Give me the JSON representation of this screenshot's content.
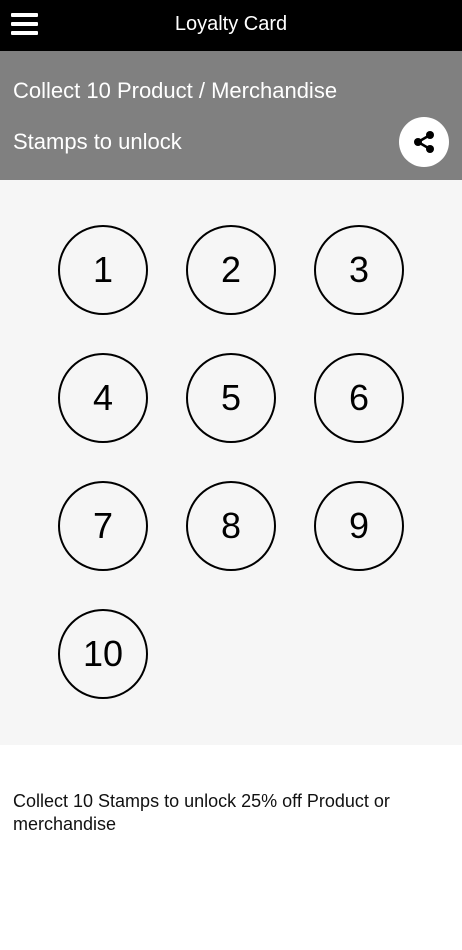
{
  "header": {
    "title": "Loyalty Card",
    "menu_icon": "hamburger-menu-icon"
  },
  "banner": {
    "text": "Collect 10 Product / Merchandise Stamps to unlock",
    "share_icon": "share-icon",
    "background_color": "#808080"
  },
  "stamps": {
    "total": 10,
    "collected": 0,
    "labels": [
      "1",
      "2",
      "3",
      "4",
      "5",
      "6",
      "7",
      "8",
      "9",
      "10"
    ]
  },
  "description": "Collect 10 Stamps to unlock 25% off Product or merchandise"
}
